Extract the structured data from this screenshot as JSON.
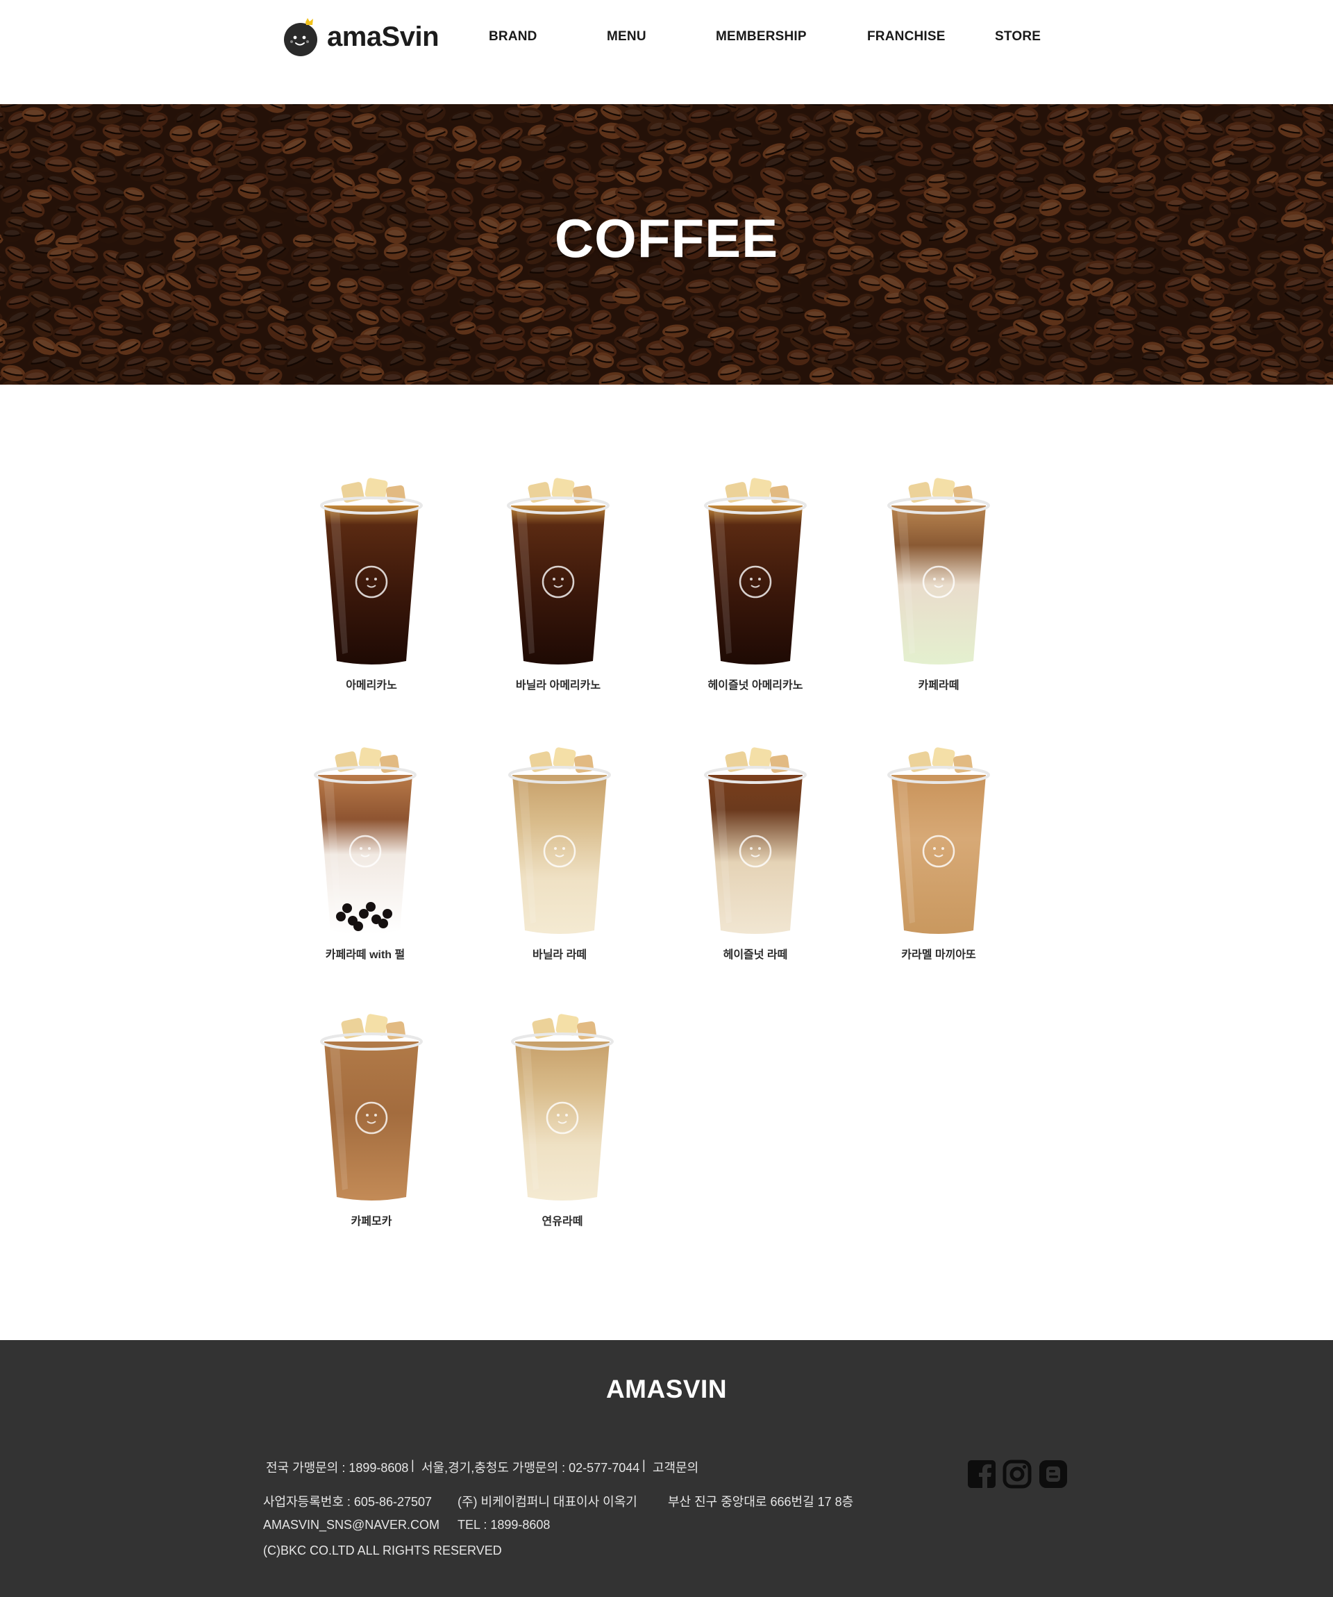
{
  "header": {
    "logo_text": "amaSvin",
    "nav": [
      "BRAND",
      "MENU",
      "MEMBERSHIP",
      "FRANCHISE",
      "STORE"
    ]
  },
  "hero": {
    "title": "COFFEE"
  },
  "products": [
    {
      "name": "아메리카노",
      "style": "americano"
    },
    {
      "name": "바닐라 아메리카노",
      "style": "americano"
    },
    {
      "name": "헤이즐넛 아메리카노",
      "style": "americano"
    },
    {
      "name": "카페라떼",
      "style": "latte"
    },
    {
      "name": "카페라떼 with 펄",
      "style": "pearl"
    },
    {
      "name": "바닐라 라떼",
      "style": "vanilla"
    },
    {
      "name": "헤이즐넛 라떼",
      "style": "hazel"
    },
    {
      "name": "카라멜 마끼아또",
      "style": "caramel"
    },
    {
      "name": "카페모카",
      "style": "mocha"
    },
    {
      "name": "연유라떼",
      "style": "vanilla"
    }
  ],
  "footer": {
    "brand": "AMASVIN",
    "inquiry_national": "전국 가맹문의 : 1899-8608",
    "separator": "|",
    "inquiry_region": "서울,경기,충청도 가맹문의 : 02-577-7044",
    "customer_inquiry": "고객문의",
    "business_no": "사업자등록번호 : 605-86-27507",
    "company": "(주) 비케이컴퍼니 대표이사 이옥기",
    "address": "부산 진구 중앙대로 666번길 17 8층",
    "email": "AMASVIN_SNS@NAVER.COM",
    "tel": "TEL : 1899-8608",
    "copyright": "(C)BKC CO.LTD ALL RIGHTS RESERVED",
    "social": [
      "facebook-icon",
      "instagram-icon",
      "blog-icon"
    ]
  },
  "colors": {
    "footer_bg": "#333333",
    "hero_bg": "#2a140a",
    "text_dark": "#1a1a1a",
    "logo_crown": "#f2c21b"
  }
}
